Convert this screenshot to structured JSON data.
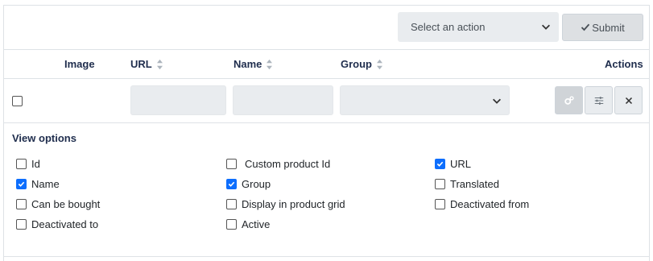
{
  "action_bar": {
    "select_placeholder": "Select an action",
    "submit_label": "Submit"
  },
  "table": {
    "columns": [
      {
        "label": "Image",
        "sortable": false
      },
      {
        "label": "URL",
        "sortable": true
      },
      {
        "label": "Name",
        "sortable": true
      },
      {
        "label": "Group",
        "sortable": true
      },
      {
        "label": "Actions",
        "sortable": false
      }
    ]
  },
  "filter_row": {
    "row_checkbox_checked": false,
    "buttons": [
      "gears-icon",
      "sliders-icon",
      "close-icon"
    ]
  },
  "view_options": {
    "title": "View options",
    "options": [
      {
        "label": "Id",
        "checked": false
      },
      {
        "label": "Custom product Id",
        "checked": false
      },
      {
        "label": "URL",
        "checked": true
      },
      {
        "label": "Name",
        "checked": true
      },
      {
        "label": "Group",
        "checked": true
      },
      {
        "label": "Translated",
        "checked": false
      },
      {
        "label": "Can be bought",
        "checked": false
      },
      {
        "label": "Display in product grid",
        "checked": false
      },
      {
        "label": "Deactivated from",
        "checked": false
      },
      {
        "label": "Deactivated to",
        "checked": false
      },
      {
        "label": "Active",
        "checked": false
      }
    ]
  },
  "colors": {
    "accent": "#0d6efd",
    "header_text": "#1f2d4d",
    "input_bg": "#e9ecef"
  }
}
